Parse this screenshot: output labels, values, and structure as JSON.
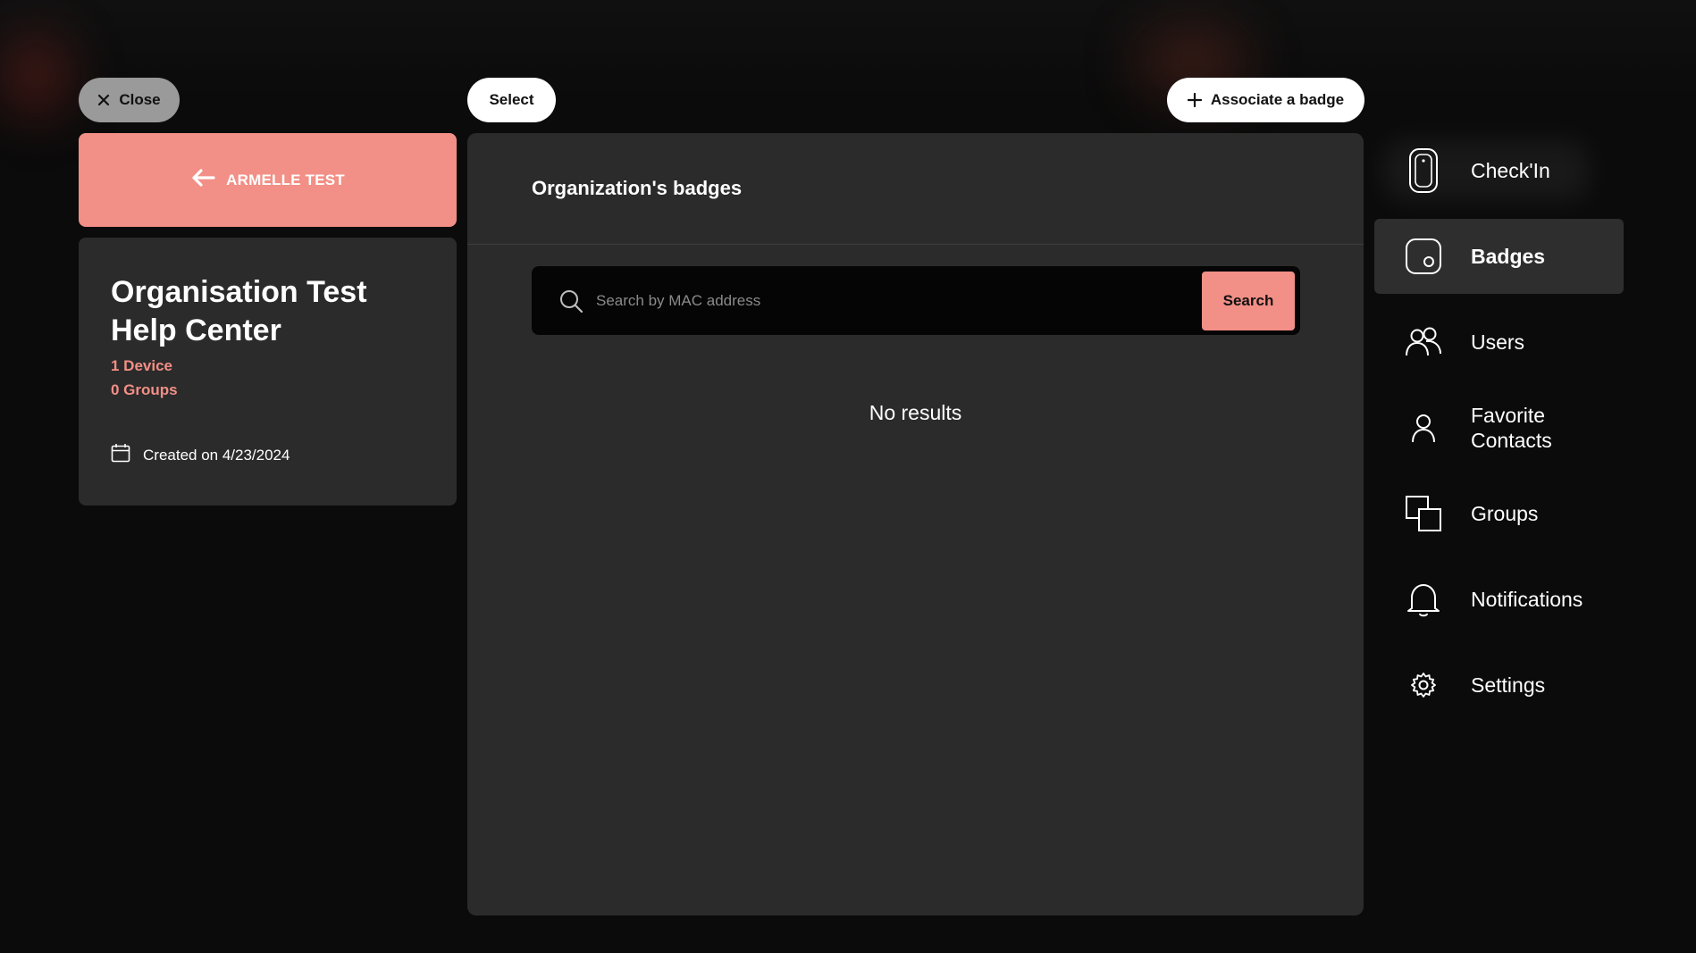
{
  "top_bar": {
    "close_label": "Close",
    "select_label": "Select",
    "associate_label": "Associate a badge"
  },
  "left_panel": {
    "back_label": "ARMELLE TEST",
    "org_name": "Organisation Test Help Center",
    "devices": "1 Device",
    "groups": "0 Groups",
    "created": "Created on 4/23/2024"
  },
  "main": {
    "title": "Organization's badges",
    "search": {
      "placeholder": "Search by MAC address",
      "value": "",
      "button_label": "Search"
    },
    "empty_text": "No results"
  },
  "nav": {
    "items": [
      {
        "label": "Check'In",
        "icon": "phone-icon",
        "active": false
      },
      {
        "label": "Badges",
        "icon": "badge-icon",
        "active": true
      },
      {
        "label": "Users",
        "icon": "users-icon",
        "active": false
      },
      {
        "label": "Favorite Contacts",
        "icon": "user-icon",
        "active": false
      },
      {
        "label": "Groups",
        "icon": "groups-icon",
        "active": false
      },
      {
        "label": "Notifications",
        "icon": "bell-icon",
        "active": false
      },
      {
        "label": "Settings",
        "icon": "gear-icon",
        "active": false
      }
    ]
  },
  "colors": {
    "accent": "#f28f86",
    "background": "#0b0b0b",
    "panel": "#2b2b2b",
    "search_bg": "#050505"
  }
}
